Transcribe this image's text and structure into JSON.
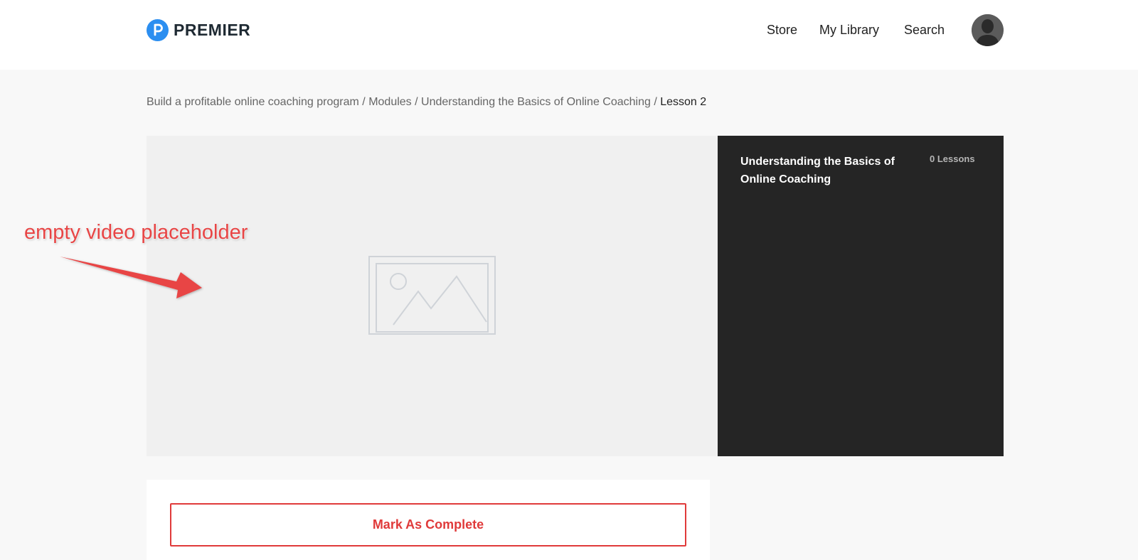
{
  "header": {
    "brand": "PREMIER",
    "nav": {
      "store": "Store",
      "library": "My Library",
      "search": "Search"
    }
  },
  "breadcrumb": {
    "course": "Build a profitable online coaching program",
    "sep1": " / ",
    "modules": "Modules",
    "sep2": " / ",
    "module": "Understanding the Basics of Online Coaching",
    "sep3": " / ",
    "lesson": "Lesson 2"
  },
  "video": {
    "icon": "image-placeholder-icon"
  },
  "side_panel": {
    "title": "Understanding the Basics of Online Coaching",
    "lesson_count": "0 Lessons"
  },
  "actions": {
    "mark_complete": "Mark As Complete"
  },
  "annotation": {
    "text": "empty video placeholder"
  },
  "colors": {
    "brand_blue": "#2b8ef0",
    "accent_red": "#e03a3a",
    "panel_dark": "#252525",
    "annotation_red": "#e84545"
  }
}
